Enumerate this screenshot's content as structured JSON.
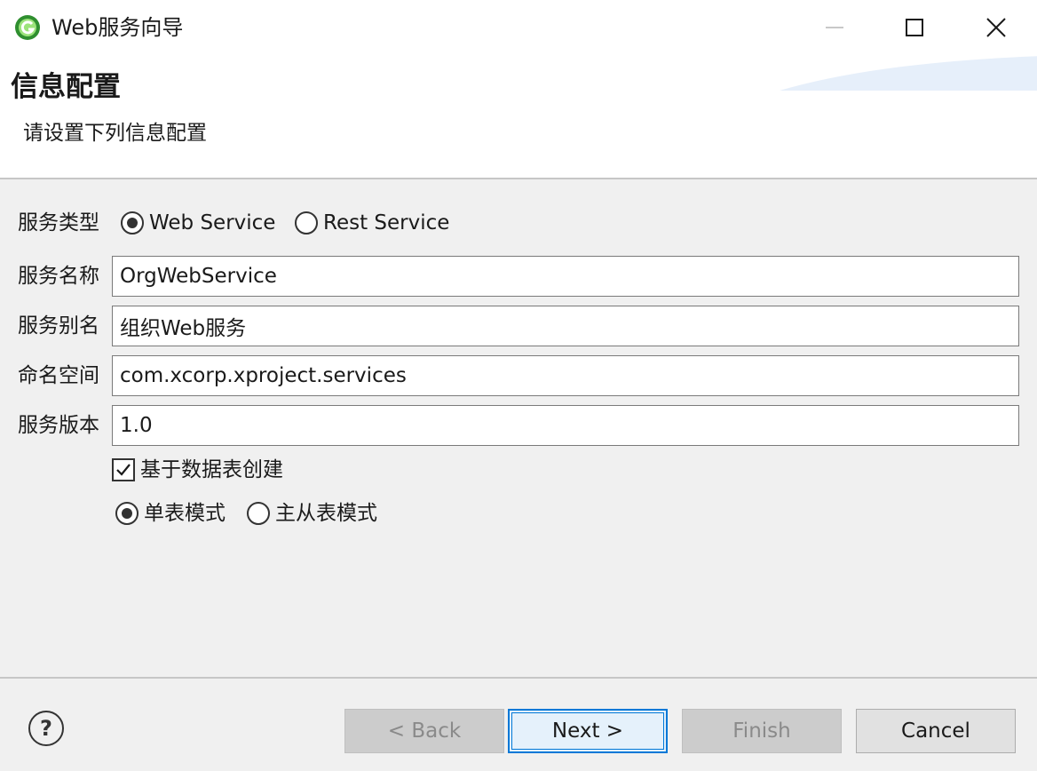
{
  "window": {
    "title": "Web服务向导",
    "icon": "app-logo-icon",
    "controls": {
      "minimize": "minimize-icon",
      "maximize": "maximize-icon",
      "close": "close-icon"
    }
  },
  "header": {
    "title": "信息配置",
    "description": "请设置下列信息配置"
  },
  "form": {
    "service_type": {
      "label": "服务类型",
      "options": [
        {
          "label": "Web Service",
          "selected": true
        },
        {
          "label": "Rest Service",
          "selected": false
        }
      ]
    },
    "service_name": {
      "label": "服务名称",
      "value": "OrgWebService"
    },
    "service_alias": {
      "label": "服务别名",
      "value": "组织Web服务"
    },
    "namespace": {
      "label": "命名空间",
      "value": "com.xcorp.xproject.services"
    },
    "version": {
      "label": "服务版本",
      "value": "1.0"
    },
    "create_from_table": {
      "label": "基于数据表创建",
      "checked": true
    },
    "table_mode": {
      "options": [
        {
          "label": "单表模式",
          "selected": true
        },
        {
          "label": "主从表模式",
          "selected": false
        }
      ]
    }
  },
  "footer": {
    "help_icon": "help-icon",
    "help_glyph": "?",
    "back_label": "< Back",
    "next_label": "Next >",
    "finish_label": "Finish",
    "cancel_label": "Cancel"
  },
  "colors": {
    "accent": "#0078d7",
    "background": "#f0f0f0",
    "banner": "#ffffff"
  }
}
